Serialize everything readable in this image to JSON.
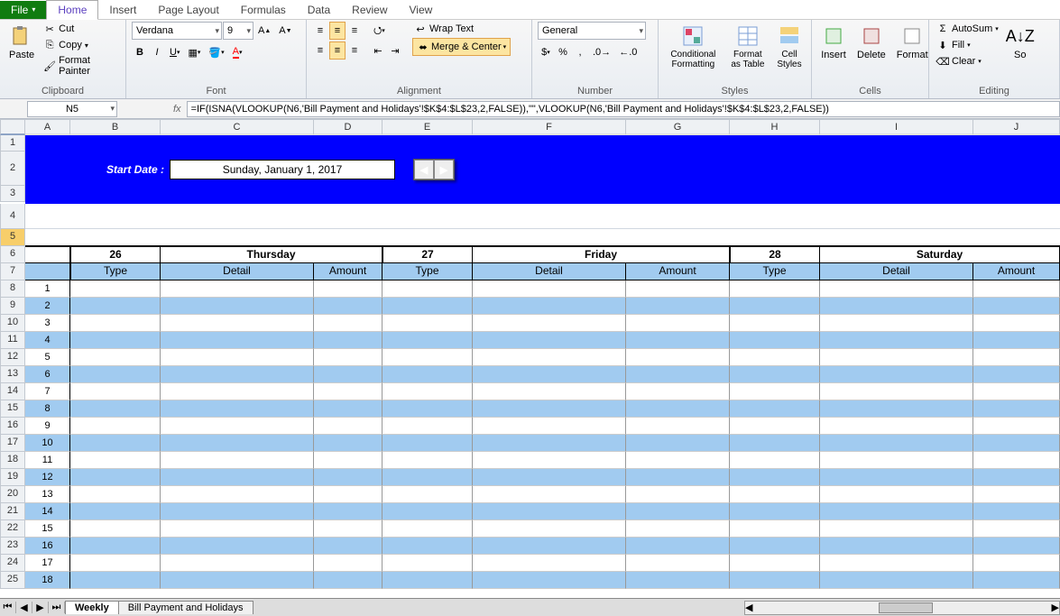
{
  "tabs": {
    "file": "File",
    "home": "Home",
    "insert": "Insert",
    "pagelayout": "Page Layout",
    "formulas": "Formulas",
    "data": "Data",
    "review": "Review",
    "view": "View"
  },
  "clipboard": {
    "paste": "Paste",
    "cut": "Cut",
    "copy": "Copy",
    "fmtpainter": "Format Painter",
    "label": "Clipboard"
  },
  "font": {
    "name": "Verdana",
    "size": "9",
    "label": "Font"
  },
  "alignment": {
    "wrap": "Wrap Text",
    "merge": "Merge & Center",
    "label": "Alignment"
  },
  "number": {
    "format": "General",
    "label": "Number"
  },
  "styles": {
    "cond": "Conditional Formatting",
    "table": "Format as Table",
    "cell": "Cell Styles",
    "label": "Styles"
  },
  "cells": {
    "insert": "Insert",
    "delete": "Delete",
    "format": "Format",
    "label": "Cells"
  },
  "editing": {
    "autosum": "AutoSum",
    "fill": "Fill",
    "clear": "Clear",
    "sort": "So",
    "label": "Editing"
  },
  "namebox": "N5",
  "formula": "=IF(ISNA(VLOOKUP(N6,'Bill Payment and Holidays'!$K$4:$L$23,2,FALSE)),\"\",VLOOKUP(N6,'Bill Payment and Holidays'!$K$4:$L$23,2,FALSE))",
  "cols": [
    "A",
    "B",
    "C",
    "D",
    "E",
    "F",
    "G",
    "H",
    "I",
    "J"
  ],
  "banner": {
    "label": "Start Date :",
    "date": "Sunday, January 1, 2017"
  },
  "days": [
    {
      "num": "26",
      "name": "Thursday"
    },
    {
      "num": "27",
      "name": "Friday"
    },
    {
      "num": "28",
      "name": "Saturday"
    }
  ],
  "sub": [
    "Type",
    "Detail",
    "Amount"
  ],
  "rownums": [
    1,
    2,
    3,
    4,
    5,
    6,
    7,
    8,
    9,
    10,
    11,
    12,
    13,
    14,
    15,
    16,
    17,
    18
  ],
  "sheets": {
    "active": "Weekly",
    "other": "Bill Payment and Holidays"
  },
  "colwidths": {
    "A": 50,
    "B": 100,
    "C": 170,
    "D": 76,
    "E": 100,
    "F": 170,
    "G": 115,
    "H": 100,
    "I": 170,
    "J": 96
  }
}
